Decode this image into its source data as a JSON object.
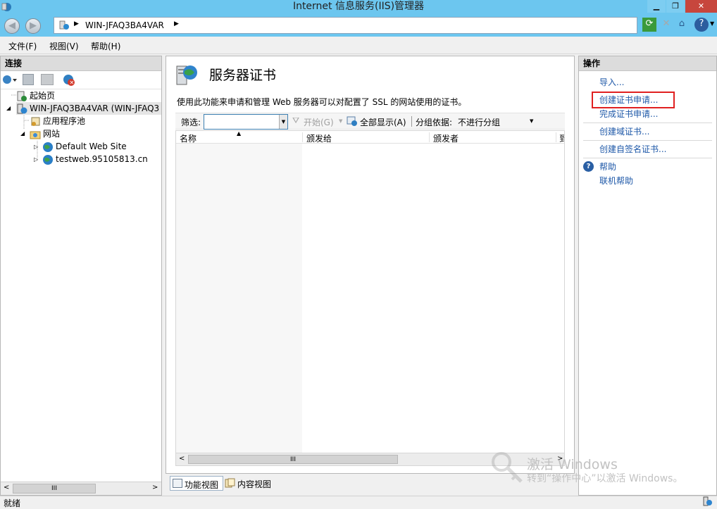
{
  "window": {
    "title": "Internet 信息服务(IIS)管理器"
  },
  "address": {
    "server": "WIN-JFAQ3BA4VAR"
  },
  "menu": {
    "file": "文件(F)",
    "view": "视图(V)",
    "help": "帮助(H)"
  },
  "connections": {
    "header": "连接",
    "tree": {
      "start_page": "起始页",
      "server": "WIN-JFAQ3BA4VAR (WIN-JFAQ3",
      "app_pools": "应用程序池",
      "sites": "网站",
      "site1": "Default Web Site",
      "site2": "testweb.95105813.cn"
    }
  },
  "main": {
    "title": "服务器证书",
    "description": "使用此功能来申请和管理 Web 服务器可以对配置了 SSL 的网站使用的证书。",
    "filter_label": "筛选:",
    "filter_value": "",
    "go_label": "开始(G)",
    "show_all_label": "全部显示(A)",
    "group_by_label": "分组依据:",
    "group_by_value": "不进行分组",
    "columns": [
      "名称",
      "颁发给",
      "颁发者",
      "到"
    ],
    "scroll_grip": "III",
    "tabs": {
      "features": "功能视图",
      "content": "内容视图"
    }
  },
  "actions": {
    "header": "操作",
    "import": "导入...",
    "create_request": "创建证书申请...",
    "complete_request": "完成证书申请...",
    "create_domain": "创建域证书...",
    "create_selfsigned": "创建自签名证书...",
    "help": "帮助",
    "online_help": "联机帮助"
  },
  "watermark": {
    "line1": "激活 Windows",
    "line2": "转到“操作中心”以激活 Windows。"
  },
  "status": {
    "text": "就绪"
  },
  "colors": {
    "titlebar": "#6cc6ef",
    "link": "#1e58a8",
    "highlight_box": "#e02020",
    "close": "#c7463d"
  }
}
